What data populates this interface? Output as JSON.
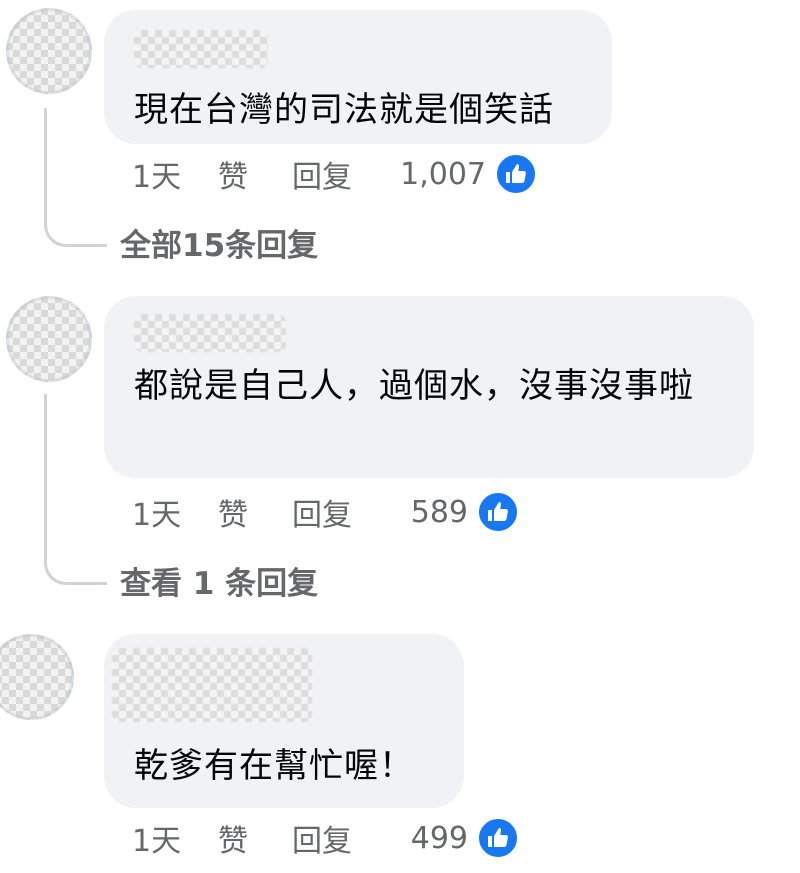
{
  "comments": [
    {
      "text": "現在台灣的司法就是個笑話",
      "time": "1天",
      "like_label": "赞",
      "reply_label": "回复",
      "reaction_count": "1,007",
      "view_replies": "全部15条回复"
    },
    {
      "text": "都說是自己人，過個水，沒事沒事啦",
      "time": "1天",
      "like_label": "赞",
      "reply_label": "回复",
      "reaction_count": "589",
      "view_replies": "查看 1 条回复"
    },
    {
      "text": "乾爹有在幫忙喔！",
      "time": "1天",
      "like_label": "赞",
      "reply_label": "回复",
      "reaction_count": "499"
    }
  ],
  "colors": {
    "bubble": "#f0f2f5",
    "secondary_text": "#65676b",
    "like_blue": "#1877f2"
  },
  "icons": {
    "reaction": "thumbs-up-icon"
  }
}
